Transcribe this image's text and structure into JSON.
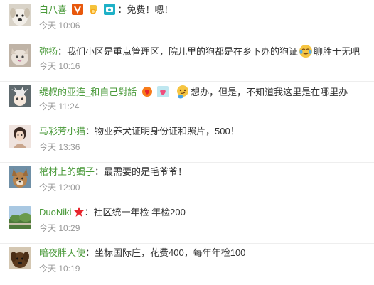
{
  "comments": [
    {
      "user": "白八喜",
      "sep": "：",
      "text": "免费！嗯！",
      "time": "今天 10:06"
    },
    {
      "user": "弥扬",
      "sep": "：",
      "text_before": "我们小区是重点管理区，院儿里的狗都是在乡下办的狗证",
      "text_after": "聊胜于无吧",
      "emoji_icon": "crying-laugh-emoji-icon",
      "time": "今天 10:16"
    },
    {
      "user": "缇叔的亚连_和自己對話",
      "sep": "",
      "text_before": "",
      "text_after": "想办，但是，不知道我这里是在哪里办",
      "emoji_icon": "thinking-face-emoji-icon",
      "time": "今天 11:24"
    },
    {
      "user": "马彩芳小猫",
      "sep": "：",
      "text": "物业养犬证明身份证和照片，500！",
      "time": "今天 13:36"
    },
    {
      "user": "棺材上的蝎子",
      "sep": "：",
      "text": "最需要的是毛爷爷！",
      "time": "今天 12:00"
    },
    {
      "user": "DuoNiki",
      "sep": "：",
      "text": "社区统一年检 年检200",
      "time": "今天 10:29"
    },
    {
      "user": "暗夜胖天使",
      "sep": "：",
      "text": "坐标国际庄，花费400，每年年检100",
      "time": "今天 10:19"
    }
  ],
  "colors": {
    "username": "#4a9a3a",
    "time": "#999999",
    "text": "#333333"
  },
  "icons": {
    "row1_badges": [
      "vip-v-badge-icon",
      "medal-badge-icon",
      "camera-badge-icon"
    ],
    "row3_badges": [
      "fire-heart-badge-icon",
      "heart-badge-icon"
    ],
    "row6_badges": [
      "red-star-badge-icon"
    ]
  }
}
